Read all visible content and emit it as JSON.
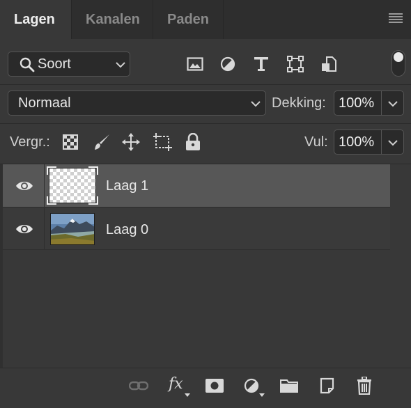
{
  "tabs": [
    {
      "label": "Lagen"
    },
    {
      "label": "Kanalen"
    },
    {
      "label": "Paden"
    }
  ],
  "filter": {
    "kind_label": "Soort",
    "icons": [
      "image-filter-icon",
      "adjustment-filter-icon",
      "type-filter-icon",
      "shape-filter-icon",
      "smart-object-filter-icon"
    ]
  },
  "blend": {
    "mode": "Normaal",
    "opacity_label": "Dekking:",
    "opacity_value": "100%"
  },
  "lock": {
    "label": "Vergr.:",
    "fill_label": "Vul:",
    "fill_value": "100%"
  },
  "layers": [
    {
      "name": "Laag 1",
      "selected": true,
      "visible": true
    },
    {
      "name": "Laag 0",
      "selected": false,
      "visible": true
    }
  ],
  "bottom_icons": [
    "link-layers-icon",
    "fx-icon",
    "mask-icon",
    "adjustment-layer-icon",
    "group-folder-icon",
    "new-layer-icon",
    "trash-icon"
  ],
  "fx_text": "fx",
  "colors": {
    "panel": "#383838",
    "tab_bar": "#2e2e2e",
    "selected_layer": "#575757",
    "field": "#2a2a2a"
  }
}
